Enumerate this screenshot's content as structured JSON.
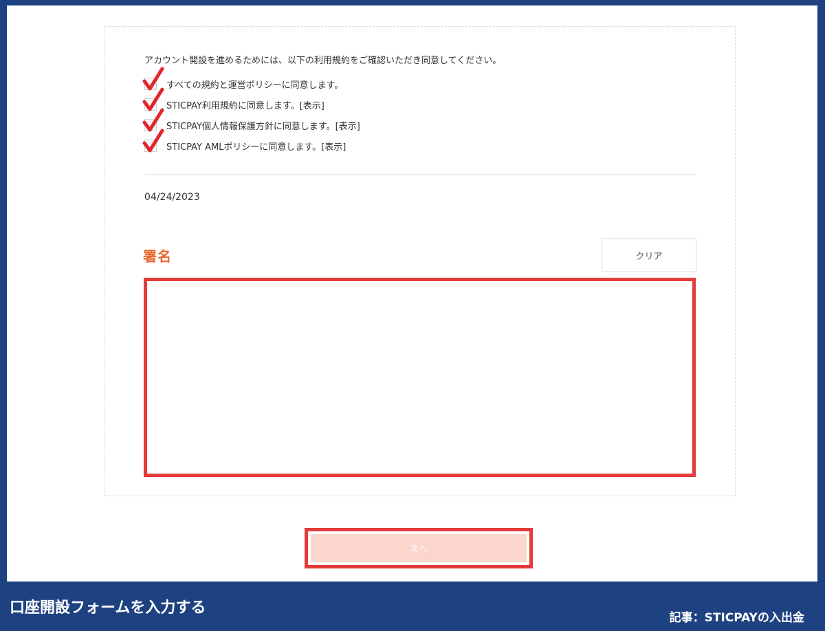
{
  "form": {
    "intro_text": "アカウント開設を進めるためには、以下の利用規約をご確認いただき同意してください。",
    "agreements": [
      {
        "label": "すべての規約と運営ポリシーに同意します。",
        "checked": true
      },
      {
        "label": "STICPAY利用規約に同意します。[表示]",
        "checked": true
      },
      {
        "label": "STICPAY個人情報保護方針に同意します。[表示]",
        "checked": true
      },
      {
        "label": "STICPAY AMLポリシーに同意します。[表示]",
        "checked": true
      }
    ],
    "date": "04/24/2023",
    "signature_title": "署名",
    "clear_label": "クリア",
    "next_label": "次へ"
  },
  "caption": {
    "title": "口座開設フォームを入力する",
    "source": "記事：STICPAYの入出金"
  },
  "colors": {
    "frame": "#1e4281",
    "highlight": "#e53a3a",
    "accent": "#e8672c",
    "button_disabled": "#fbd6cc",
    "checkmark": "#e0262b"
  },
  "icons": {
    "check": "checkmark-icon"
  }
}
